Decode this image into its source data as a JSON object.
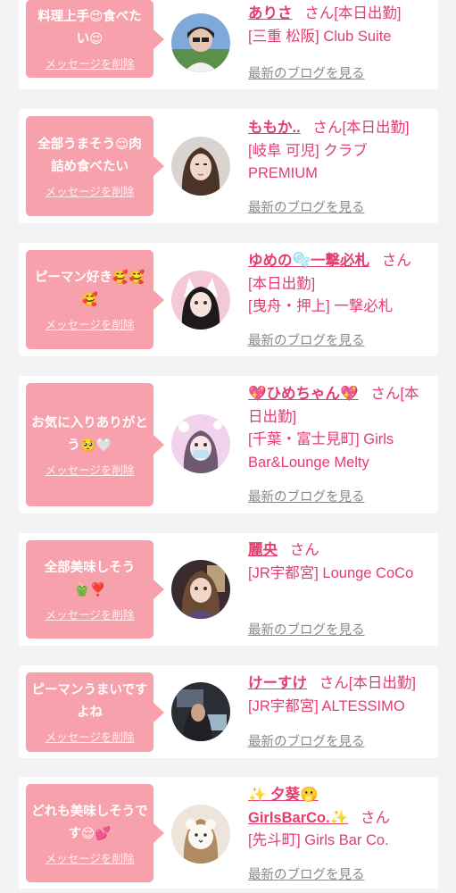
{
  "common": {
    "delete_label": "メッセージを削除",
    "blog_label": "最新のブログを見る",
    "san": "さん"
  },
  "colors": {
    "bubble": "#f7a1ad",
    "accent": "#e33d6e",
    "link_gray": "#8a8a8a",
    "background": "#f3f3f3"
  },
  "cards": [
    {
      "message": "料理上手😍食べたい😌",
      "name": "ありさ",
      "status": "[本日出勤]",
      "shop": "[三重 松阪] Club Suite"
    },
    {
      "message": "全部うまそう😌肉詰め食べたい",
      "name": "ももか..",
      "status": "[本日出勤]",
      "shop": "[岐阜 可児] クラブPREMIUM"
    },
    {
      "message": "ピーマン好き🥰🥰🥰",
      "name": "ゆめの🫧一撃必札",
      "status": "[本日出勤]",
      "shop": "[曳舟・押上] 一撃必札"
    },
    {
      "message": "お気に入りありがとう🥺🤍",
      "name": "💖ひめちゃん💖",
      "status": "[本日出勤]",
      "shop": "[千葉・富士見町] Girls Bar&Lounge Melty"
    },
    {
      "message": "全部美味しそう🫑❣️",
      "name": "麗央",
      "status": "",
      "shop": "[JR宇都宮] Lounge CoCo"
    },
    {
      "message": "ピーマンうまいですよね",
      "name": "けーすけ",
      "status": "[本日出勤]",
      "shop": "[JR宇都宮] ALTESSIMO"
    },
    {
      "message": "どれも美味しそうです😌💕",
      "name": "✨ 夕葵🫢GirlsBarCo.✨",
      "status": "",
      "shop": "[先斗町] Girls Bar Co."
    }
  ]
}
